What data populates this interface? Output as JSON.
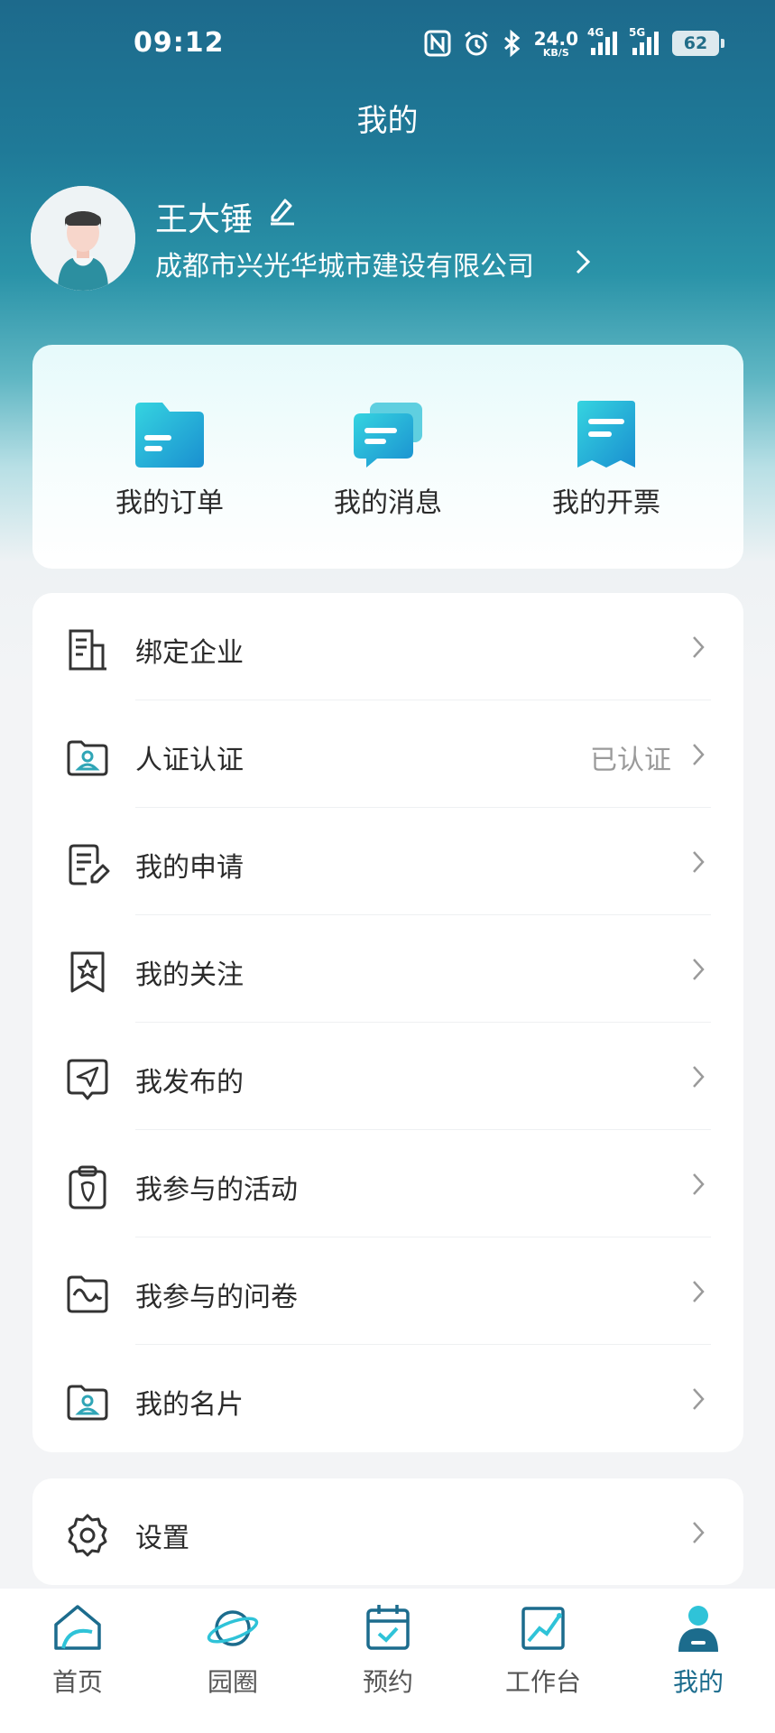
{
  "status_bar": {
    "time": "09:12",
    "net_speed": "24.0",
    "net_unit": "KB/S",
    "signal1": "4G",
    "signal2": "5G",
    "battery": "62"
  },
  "header": {
    "title": "我的"
  },
  "profile": {
    "name": "王大锤",
    "company": "成都市兴光华城市建设有限公司"
  },
  "quick_actions": [
    {
      "label": "我的订单",
      "icon": "folder-icon"
    },
    {
      "label": "我的消息",
      "icon": "message-icon"
    },
    {
      "label": "我的开票",
      "icon": "invoice-icon"
    }
  ],
  "menu": [
    {
      "label": "绑定企业",
      "value": "",
      "icon": "building-icon"
    },
    {
      "label": "人证认证",
      "value": "已认证",
      "icon": "id-card-icon"
    },
    {
      "label": "我的申请",
      "value": "",
      "icon": "application-icon"
    },
    {
      "label": "我的关注",
      "value": "",
      "icon": "star-bookmark-icon"
    },
    {
      "label": "我发布的",
      "value": "",
      "icon": "send-icon"
    },
    {
      "label": "我参与的活动",
      "value": "",
      "icon": "activity-icon"
    },
    {
      "label": "我参与的问卷",
      "value": "",
      "icon": "survey-icon"
    },
    {
      "label": "我的名片",
      "value": "",
      "icon": "business-card-icon"
    }
  ],
  "settings": {
    "label": "设置",
    "icon": "gear-icon"
  },
  "tab_bar": [
    {
      "label": "首页",
      "icon": "home-icon",
      "active": false
    },
    {
      "label": "园圈",
      "icon": "planet-icon",
      "active": false
    },
    {
      "label": "预约",
      "icon": "calendar-icon",
      "active": false
    },
    {
      "label": "工作台",
      "icon": "chart-icon",
      "active": false
    },
    {
      "label": "我的",
      "icon": "user-icon",
      "active": true
    }
  ],
  "colors": {
    "primary": "#1c6c8d",
    "accent_cyan": "#2fc3d8",
    "text": "#2b2b2b",
    "muted": "#9a9a9a"
  }
}
